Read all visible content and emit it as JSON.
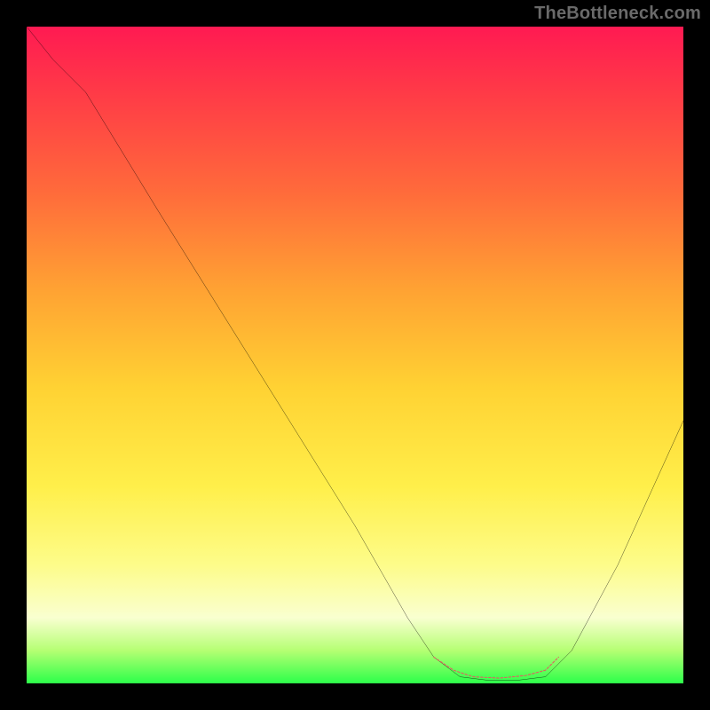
{
  "watermark": "TheBottleneck.com",
  "chart_data": {
    "type": "line",
    "title": "",
    "xlabel": "",
    "ylabel": "",
    "xlim": [
      0,
      100
    ],
    "ylim": [
      0,
      100
    ],
    "gradient_stops": [
      {
        "pct": 0,
        "color": "#ff1a52"
      },
      {
        "pct": 10,
        "color": "#ff3a47"
      },
      {
        "pct": 25,
        "color": "#ff6a3b"
      },
      {
        "pct": 40,
        "color": "#ffa233"
      },
      {
        "pct": 55,
        "color": "#ffd233"
      },
      {
        "pct": 70,
        "color": "#ffef4a"
      },
      {
        "pct": 82,
        "color": "#fdfc8a"
      },
      {
        "pct": 90,
        "color": "#f9ffd0"
      },
      {
        "pct": 95,
        "color": "#b5ff73"
      },
      {
        "pct": 100,
        "color": "#2cff4a"
      }
    ],
    "series": [
      {
        "name": "main-curve",
        "color": "#000000",
        "points": [
          {
            "x": 0,
            "y": 100
          },
          {
            "x": 4,
            "y": 95
          },
          {
            "x": 9,
            "y": 90
          },
          {
            "x": 20,
            "y": 72
          },
          {
            "x": 35,
            "y": 48
          },
          {
            "x": 50,
            "y": 24
          },
          {
            "x": 58,
            "y": 10
          },
          {
            "x": 62,
            "y": 4
          },
          {
            "x": 66,
            "y": 1
          },
          {
            "x": 70,
            "y": 0.5
          },
          {
            "x": 75,
            "y": 0.5
          },
          {
            "x": 79,
            "y": 1
          },
          {
            "x": 83,
            "y": 5
          },
          {
            "x": 90,
            "y": 18
          },
          {
            "x": 100,
            "y": 40
          }
        ]
      },
      {
        "name": "bottom-segment",
        "color": "#e06060",
        "points": [
          {
            "x": 62,
            "y": 4
          },
          {
            "x": 65,
            "y": 2
          },
          {
            "x": 68,
            "y": 1
          },
          {
            "x": 72,
            "y": 0.8
          },
          {
            "x": 76,
            "y": 1.2
          },
          {
            "x": 79,
            "y": 2
          },
          {
            "x": 81,
            "y": 4
          }
        ]
      }
    ]
  }
}
